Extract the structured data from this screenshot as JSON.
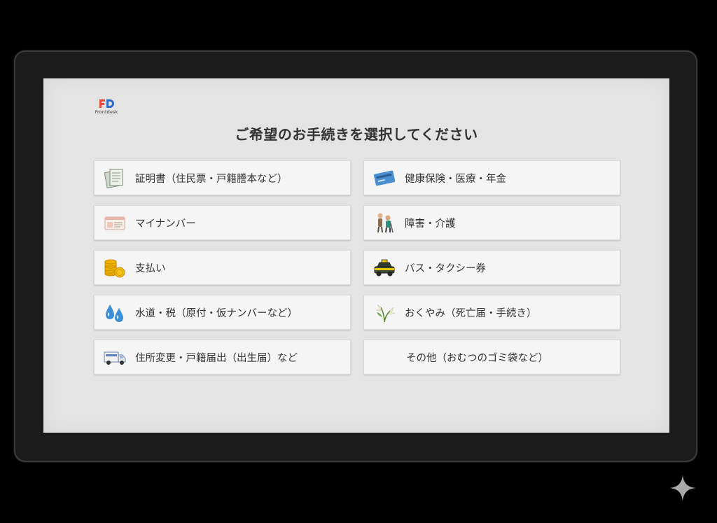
{
  "app": {
    "logo_text": "Frontdesk"
  },
  "header": {
    "title": "ご希望のお手続きを選択してください"
  },
  "menu": [
    {
      "label": "証明書（住民票・戸籍謄本など）",
      "icon": "documents-icon"
    },
    {
      "label": "健康保険・医療・年金",
      "icon": "insurance-card-icon"
    },
    {
      "label": "マイナンバー",
      "icon": "id-card-icon"
    },
    {
      "label": "障害・介護",
      "icon": "caregiver-icon"
    },
    {
      "label": "支払い",
      "icon": "coins-icon"
    },
    {
      "label": "バス・タクシー券",
      "icon": "taxi-icon"
    },
    {
      "label": "水道・税（原付・仮ナンバーなど）",
      "icon": "water-drops-icon"
    },
    {
      "label": "おくやみ（死亡届・手続き）",
      "icon": "lily-flower-icon"
    },
    {
      "label": "住所変更・戸籍届出（出生届）など",
      "icon": "moving-truck-icon"
    },
    {
      "label": "その他（おむつのゴミ袋など）",
      "icon": ""
    }
  ],
  "colors": {
    "screen_bg": "#e4e4e4",
    "button_bg": "#f5f5f5",
    "logo_red": "#e8473b",
    "logo_blue": "#2e6bc6"
  }
}
